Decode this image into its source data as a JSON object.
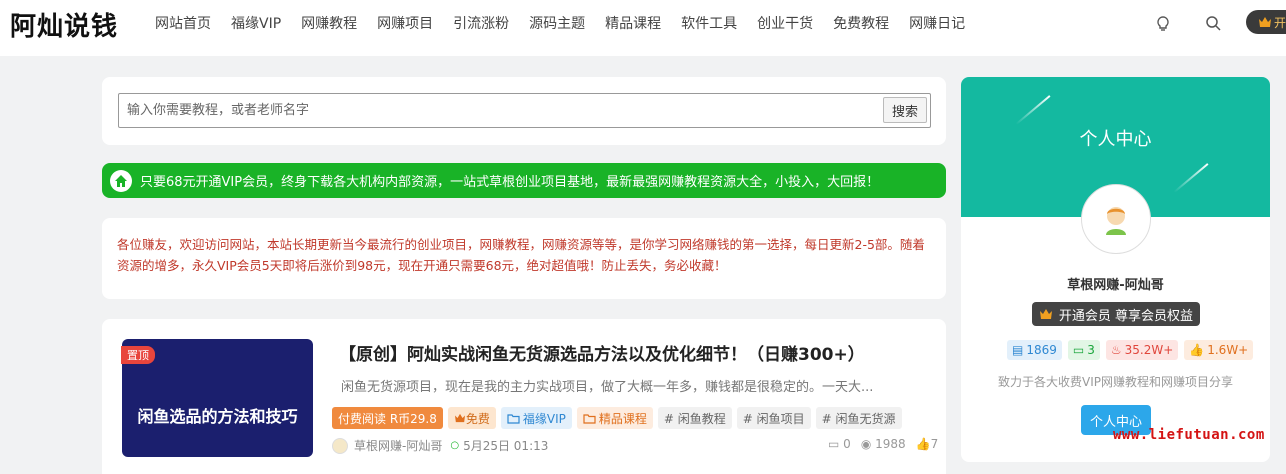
{
  "header": {
    "logo": "阿灿说钱",
    "nav": [
      "网站首页",
      "福缘VIP",
      "网赚教程",
      "网赚项目",
      "引流涨粉",
      "源码主题",
      "精品课程",
      "软件工具",
      "创业干货",
      "免费教程",
      "网赚日记"
    ],
    "vip_pill_text": "开"
  },
  "search": {
    "placeholder": "输入你需要教程，或者老师名字",
    "button": "搜索"
  },
  "promo_bar": "只要68元开通VIP会员，终身下载各大机构内部资源，一站式草根创业项目基地，最新最强网赚教程资源大全，小投入，大回报！",
  "notice": "各位赚友，欢迎访问网站，本站长期更新当今最流行的创业项目，网赚教程，网赚资源等等，是你学习网络赚钱的第一选择，每日更新2-5部。随着资源的增多，永久VIP会员5天即将后涨价到98元，现在开通只需要68元，绝对超值哦！防止丢失，务必收藏！",
  "post": {
    "badge": "置顶",
    "thumb_text": "闲鱼选品的方法和技巧",
    "title": "【原创】阿灿实战闲鱼无货源选品方法以及优化细节！（日赚300+）",
    "excerpt": "闲鱼无货源项目，现在是我的主力实战项目，做了大概一年多，赚钱都是很稳定的。一天大...",
    "tags": {
      "paid": "付费阅读 R币29.8",
      "free": "免费",
      "vip": "福缘VIP",
      "course": "精品课程",
      "t1": "# 闲鱼教程",
      "t2": "# 闲鱼项目",
      "t3": "# 闲鱼无货源"
    },
    "author": "草根网赚-阿灿哥",
    "date": "5月25日 01:13",
    "comments": "0",
    "views": "1988",
    "likes": "7"
  },
  "sidebar": {
    "banner_title": "个人中心",
    "name": "草根网赚-阿灿哥",
    "vip_button": "开通会员 尊享会员权益",
    "stats": {
      "posts": "1869",
      "comments": "3",
      "hot": "35.2W+",
      "likes": "1.6W+"
    },
    "desc": "致力于各大收费VIP网赚教程和网赚项目分享",
    "center_button": "个人中心"
  },
  "watermark": "www.liefutuan.com",
  "colors": {
    "green": "#19b327",
    "teal": "#14b9a0",
    "red_text": "#c0392b",
    "blue_button": "#2ca7ea"
  }
}
